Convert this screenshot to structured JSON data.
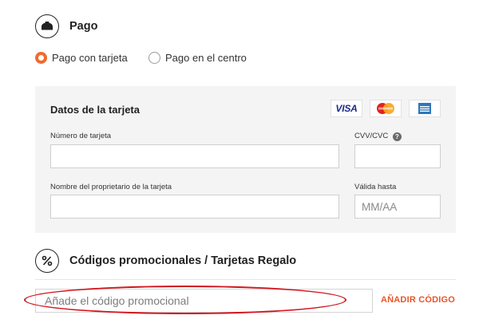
{
  "payment": {
    "title": "Pago",
    "icon": "wallet-icon",
    "options": [
      {
        "label": "Pago con tarjeta",
        "checked": true
      },
      {
        "label": "Pago en el centro",
        "checked": false
      }
    ]
  },
  "card": {
    "title": "Datos de la tarjeta",
    "brands": [
      "VISA",
      "MasterCard",
      "American Express"
    ],
    "number_label": "Número de tarjeta",
    "number_value": "",
    "cvv_label": "CVV/CVC",
    "cvv_value": "",
    "help_glyph": "?",
    "holder_label": "Nombre del proprietario de la tarjeta",
    "holder_value": "",
    "expiry_label": "Válida hasta",
    "expiry_placeholder": "MM/AA",
    "expiry_value": ""
  },
  "promo": {
    "title": "Códigos promocionales / Tarjetas Regalo",
    "icon": "percent-icon",
    "placeholder": "Añade el código promocional",
    "value": "",
    "apply_label": "AÑADIR CÓDIGO"
  },
  "colors": {
    "accent": "#f06a2e",
    "link": "#e8552a",
    "annotation": "#d2151d",
    "panel": "#f4f4f4"
  }
}
